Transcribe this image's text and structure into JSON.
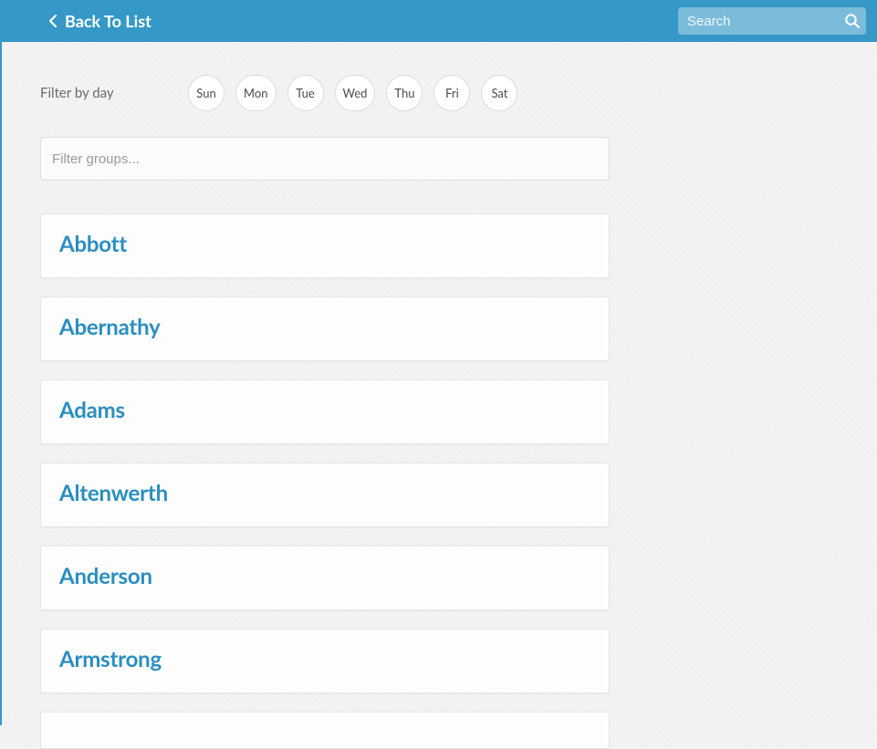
{
  "header": {
    "back_label": "Back To List",
    "search_placeholder": "Search"
  },
  "filter": {
    "label": "Filter by day",
    "days": [
      "Sun",
      "Mon",
      "Tue",
      "Wed",
      "Thu",
      "Fri",
      "Sat"
    ],
    "input_placeholder": "Filter groups..."
  },
  "groups": [
    {
      "name": "Abbott"
    },
    {
      "name": "Abernathy"
    },
    {
      "name": "Adams"
    },
    {
      "name": "Altenwerth"
    },
    {
      "name": "Anderson"
    },
    {
      "name": "Armstrong"
    }
  ],
  "colors": {
    "primary": "#3598c7",
    "link": "#2a8ec0"
  }
}
